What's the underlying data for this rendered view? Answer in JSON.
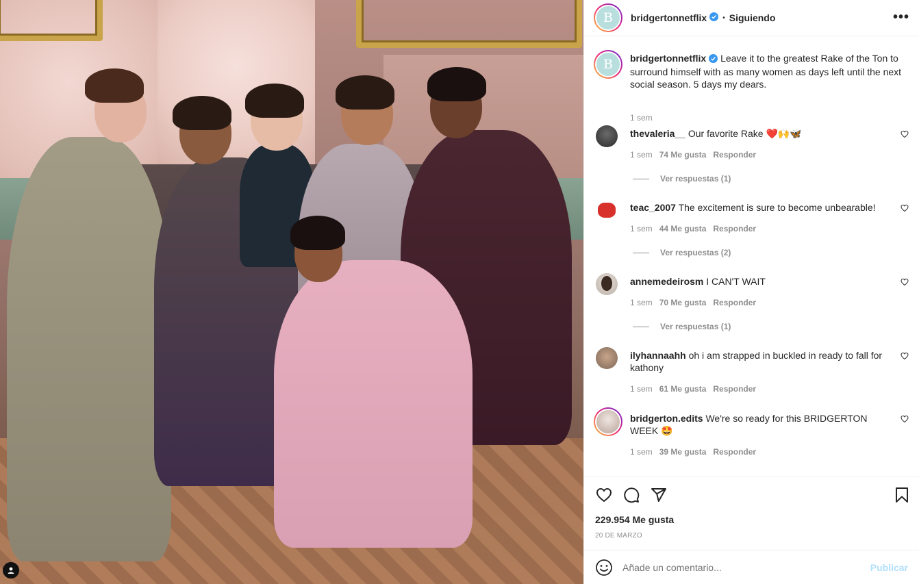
{
  "post": {
    "username": "bridgertonnetflix",
    "follow_status": "Siguiendo",
    "separator": "•",
    "more_options": "•••",
    "avatar_letter": "B",
    "caption_text": "Leave it to the greatest Rake of the Ton to surround himself with as many women as days left until the next social season. 5 days my dears.",
    "caption_time": "1 sem",
    "likes": "229.954 Me gusta",
    "date": "20 DE MARZO"
  },
  "comments": [
    {
      "user": "thevaleria__",
      "text": "Our favorite Rake ❤️🙌🦋",
      "time": "1 sem",
      "likes": "74 Me gusta",
      "reply": "Responder",
      "replies": "Ver respuestas (1)"
    },
    {
      "user": "teac_2007",
      "text": "The excitement is sure to become unbearable!",
      "time": "1 sem",
      "likes": "44 Me gusta",
      "reply": "Responder",
      "replies": "Ver respuestas (2)"
    },
    {
      "user": "annemedeirosm",
      "text": "I CAN'T WAIT",
      "time": "1 sem",
      "likes": "70 Me gusta",
      "reply": "Responder",
      "replies": "Ver respuestas (1)"
    },
    {
      "user": "ilyhannaahh",
      "text": "oh i am strapped in buckled in ready to fall for kathony",
      "time": "1 sem",
      "likes": "61 Me gusta",
      "reply": "Responder"
    },
    {
      "user": "bridgerton.edits",
      "text": "We're so ready for this BRIDGERTON WEEK 🤩",
      "time": "1 sem",
      "likes": "39 Me gusta",
      "reply": "Responder"
    }
  ],
  "add_comment": {
    "placeholder": "Añade un comentario...",
    "post_label": "Publicar"
  },
  "colors": {
    "accent": "#0095f6",
    "post_disabled": "#b2dffc",
    "muted": "#8e8e8e",
    "verified": "#3897f0",
    "like_red": "#ed4956"
  },
  "icons": {
    "like": "heart-icon",
    "comment": "comment-icon",
    "share": "paper-plane-icon",
    "save": "bookmark-icon",
    "emoji": "smiley-icon",
    "verified": "verified-badge-icon",
    "photo_tags": "user-tag-icon"
  }
}
